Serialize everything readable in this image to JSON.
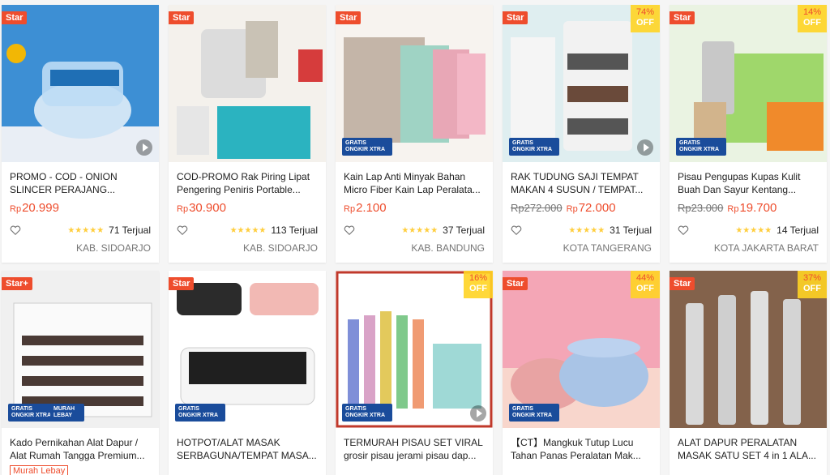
{
  "badges": {
    "star": "Star",
    "star_plus": "Star+",
    "off": "OFF",
    "gratis_line1": "GRATIS",
    "gratis_line2": "ONGKIR XTRA",
    "murah_line1": "MURAH",
    "murah_line2": "LEBAY",
    "currency": "Rp"
  },
  "products": [
    {
      "title": "PROMO - COD - ONION SLINCER PERAJANG...",
      "price": "20.999",
      "sold": "71 Terjual",
      "location": "KAB. SIDOARJO",
      "rating": 4.5
    },
    {
      "title": "COD-PROMO Rak Piring Lipat Pengering Peniris Portable...",
      "price": "30.900",
      "sold": "113 Terjual",
      "location": "KAB. SIDOARJO",
      "rating": 5
    },
    {
      "title": "Kain Lap Anti Minyak Bahan Micro Fiber Kain Lap Peralata...",
      "price": "2.100",
      "sold": "37 Terjual",
      "location": "KAB. BANDUNG",
      "rating": 5
    },
    {
      "title": "RAK TUDUNG SAJI TEMPAT MAKAN 4 SUSUN / TEMPAT...",
      "old_price": "Rp272.000",
      "price": "72.000",
      "sold": "31 Terjual",
      "location": "KOTA TANGERANG",
      "rating": 5,
      "discount": "74%"
    },
    {
      "title": "Pisau Pengupas Kupas Kulit Buah Dan Sayur Kentang...",
      "old_price": "Rp23.000",
      "price": "19.700",
      "sold": "14 Terjual",
      "location": "KOTA JAKARTA BARAT",
      "rating": 5,
      "discount": "14%"
    },
    {
      "title": "Kado Pernikahan Alat Dapur / Alat Rumah Tangga Premium...",
      "tag": "Murah Lebay"
    },
    {
      "title": "HOTPOT/ALAT MASAK SERBAGUNA/TEMPAT MASA..."
    },
    {
      "title": "TERMURAH PISAU SET VIRAL grosir pisau jerami pisau dap...",
      "discount": "16%"
    },
    {
      "title": "【CT】Mangkuk Tutup Lucu Tahan Panas Peralatan Mak...",
      "discount": "44%"
    },
    {
      "title": "ALAT DAPUR PERALATAN MASAK SATU SET 4 in 1 ALA...",
      "discount": "37%"
    }
  ],
  "colors": {
    "accent": "#ee4d2d",
    "discount_bg": "#ffd424",
    "stars": "#ffce3d",
    "gratis": "#1a4c9b"
  }
}
